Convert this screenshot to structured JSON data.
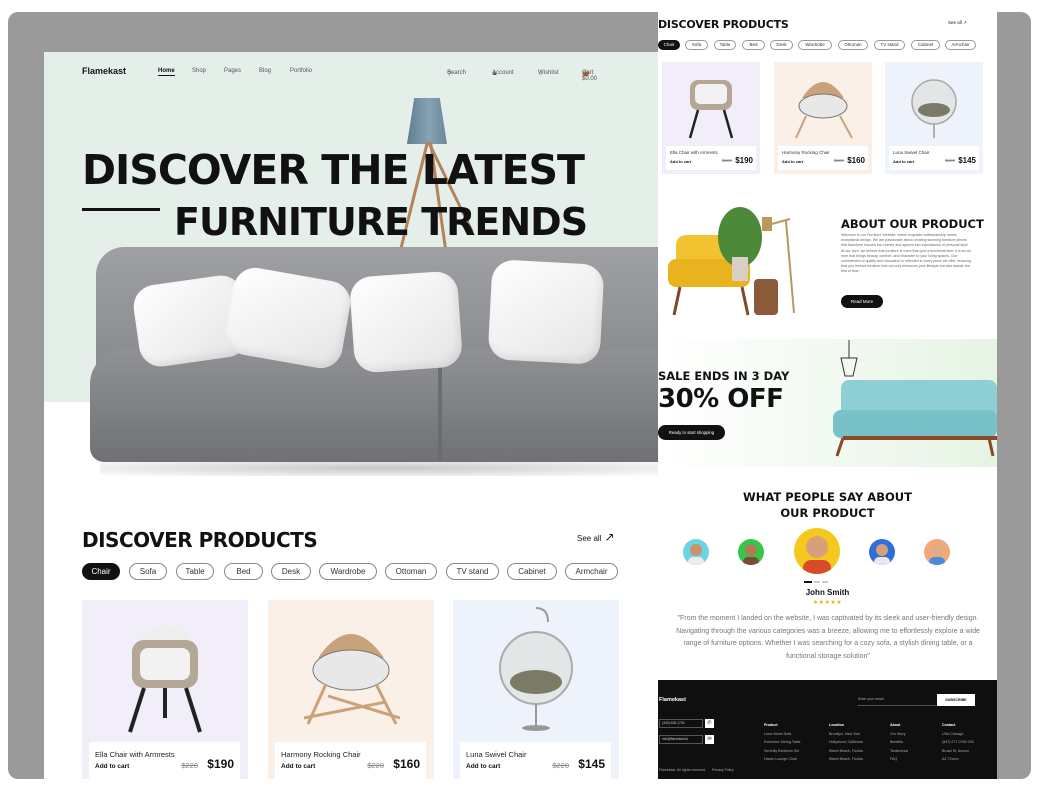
{
  "left": {
    "nav": {
      "logo": "Flamekast",
      "links": [
        "Home",
        "Shop",
        "Pages",
        "Blog",
        "Portfolio"
      ],
      "search": "Search",
      "account": "Account",
      "wishlist": "Wishlist",
      "cart": "Cart $0.00"
    },
    "hero": {
      "line1": "DISCOVER THE LATEST",
      "line2": "FURNITURE TRENDS"
    },
    "products": {
      "title": "DISCOVER PRODUCTS",
      "see_all": "See all",
      "chips": [
        "Chair",
        "Sofa",
        "Table",
        "Bed",
        "Desk",
        "Wardrobe",
        "Ottoman",
        "TV stand",
        "Cabinet",
        "Armchair"
      ],
      "items": [
        {
          "name": "Ella Chair with Armrests",
          "cart": "Add to cart",
          "old": "$220",
          "price": "$190",
          "bg": "#f1eef9"
        },
        {
          "name": "Harmony Rocking Chair",
          "cart": "Add to cart",
          "old": "$220",
          "price": "$160",
          "bg": "#fbf0e7"
        },
        {
          "name": "Luna Swivel Chair",
          "cart": "Add to cart",
          "old": "$220",
          "price": "$145",
          "bg": "#eef2fb"
        }
      ]
    }
  },
  "right": {
    "products": {
      "title": "DISCOVER PRODUCTS",
      "see_all": "See all",
      "chips": [
        "Chair",
        "Sofa",
        "Table",
        "Bed",
        "Desk",
        "Wardrobe",
        "Ottoman",
        "TV stand",
        "Cabinet",
        "Armchair"
      ],
      "items": [
        {
          "name": "Ella Chair with Armrests",
          "cart": "Add to cart",
          "old": "$220",
          "price": "$190"
        },
        {
          "name": "Harmony Rocking Chair",
          "cart": "Add to cart",
          "old": "$220",
          "price": "$160"
        },
        {
          "name": "Luna Swivel Chair",
          "cart": "Add to cart",
          "old": "$220",
          "price": "$145"
        }
      ]
    },
    "about": {
      "title": "ABOUT OUR PRODUCT",
      "text": "Welcome to our Furniture Website, where exquisite craftsmanship meets exceptional design. We are passionate about creating stunning furniture pieces that transform houses into homes and spaces into expressions of personal style. At our core, we believe that furniture is more than just a functional item; it is an art form that brings beauty, comfort, and character to your living spaces. Our commitment to quality and innovation is reflected in every piece we offer, ensuring that you receive furniture that not only enhances your lifestyle but also stands the test of time.",
      "button": "Read More"
    },
    "sale": {
      "line1": "SALE ENDS IN 3 DAY",
      "line2": "30% OFF",
      "button": "Ready to start shopping"
    },
    "testimonial": {
      "title1": "WHAT PEOPLE SAY ABOUT",
      "title2": "OUR PRODUCT",
      "name": "John Smith",
      "stars": "★★★★★",
      "quote": "\"From the moment I landed on the website, I was captivated by its sleek and user-friendly design. Navigating through the various categories was a breeze, allowing me to effortlessly explore a wide range of furniture options. Whether I was searching for a cozy sofa, a stylish dining table, or a functional storage solution\""
    },
    "footer": {
      "logo": "Flamekast",
      "email_placeholder": "Enter your email",
      "subscribe": "SUBSCRIBE",
      "phone": "(343) 628-1704",
      "email": "info@flamekast.io",
      "columns": [
        {
          "head": "Product",
          "items": [
            "Luna Velvet Sofa",
            "Extension Dining Table",
            "Serenity Bedroom Set",
            "Haven Lounge Chair"
          ]
        },
        {
          "head": "Location",
          "items": [
            "Brooklyn, New York",
            "Hollywood, California",
            "Miami Beach, Florida",
            "Miami Beach, Florida"
          ]
        },
        {
          "head": "About",
          "items": [
            "Our Story",
            "Benefits",
            "Testimonial",
            "FAQ"
          ]
        },
        {
          "head": "Contact",
          "items": [
            "USA Chicago",
            "(847) 277-0760 025",
            "Broad St, Aurora",
            "AZ 72xxxx"
          ]
        }
      ],
      "copyright": "Flamekast. All rights reserved",
      "privacy": "Privacy Policy"
    }
  }
}
